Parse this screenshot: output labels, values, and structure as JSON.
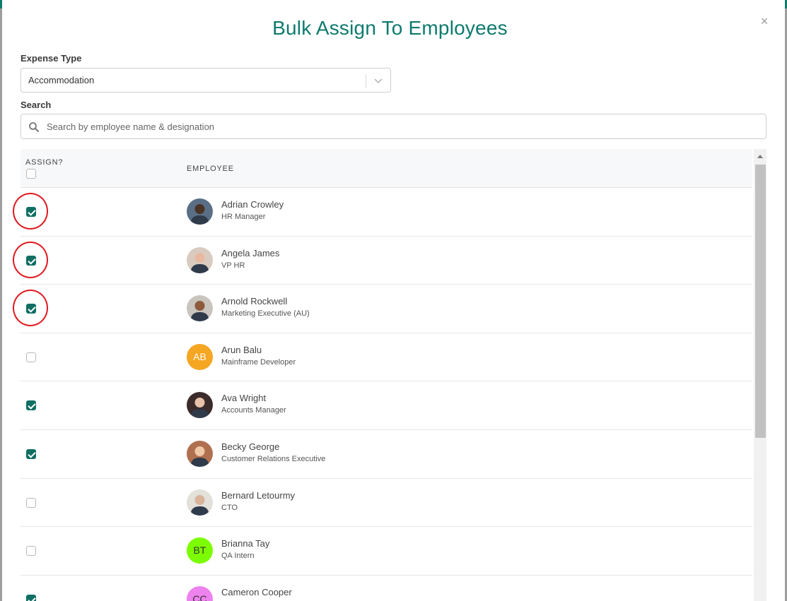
{
  "modal": {
    "title": "Bulk Assign To Employees",
    "close_label": "×"
  },
  "expense_type": {
    "label": "Expense Type",
    "value": "Accommodation"
  },
  "search": {
    "label": "Search",
    "placeholder": "Search by employee name & designation"
  },
  "table": {
    "headers": {
      "assign": "ASSIGN?",
      "employee": "EMPLOYEE"
    },
    "select_all_checked": false,
    "rows": [
      {
        "name": "Adrian Crowley",
        "title": "HR Manager",
        "checked": true,
        "highlighted": true,
        "avatar": {
          "type": "photo",
          "bg": "#5a6f86",
          "skin": "#4a3325"
        }
      },
      {
        "name": "Angela James",
        "title": "VP HR",
        "checked": true,
        "highlighted": true,
        "avatar": {
          "type": "photo",
          "bg": "#d9cbbf",
          "skin": "#e8b9a0"
        }
      },
      {
        "name": "Arnold Rockwell",
        "title": "Marketing Executive (AU)",
        "checked": true,
        "highlighted": true,
        "avatar": {
          "type": "photo",
          "bg": "#c9c4bd",
          "skin": "#8d5a3c"
        }
      },
      {
        "name": "Arun Balu",
        "title": "Mainframe Developer",
        "checked": false,
        "highlighted": false,
        "avatar": {
          "type": "initials",
          "initials": "AB",
          "bg": "#f5a623",
          "color": "#ffffff"
        }
      },
      {
        "name": "Ava Wright",
        "title": "Accounts Manager",
        "checked": true,
        "highlighted": false,
        "avatar": {
          "type": "photo",
          "bg": "#3b2b2b",
          "skin": "#e8c1a8"
        }
      },
      {
        "name": "Becky George",
        "title": "Customer Relations Executive",
        "checked": true,
        "highlighted": false,
        "avatar": {
          "type": "photo",
          "bg": "#b07050",
          "skin": "#f0c8a8"
        }
      },
      {
        "name": "Bernard Letourmy",
        "title": "CTO",
        "checked": false,
        "highlighted": false,
        "avatar": {
          "type": "photo",
          "bg": "#e4e0da",
          "skin": "#d8b49a"
        }
      },
      {
        "name": "Brianna Tay",
        "title": "QA Intern",
        "checked": false,
        "highlighted": false,
        "avatar": {
          "type": "initials",
          "initials": "BT",
          "bg": "#7cfc00",
          "color": "#333333"
        }
      },
      {
        "name": "Cameron Cooper",
        "title": "",
        "checked": true,
        "highlighted": false,
        "avatar": {
          "type": "initials",
          "initials": "CC",
          "bg": "#ee82ee",
          "color": "#333333"
        }
      }
    ]
  },
  "colors": {
    "accent": "#0e7a6e",
    "checkbox_checked": "#0f6f63",
    "highlight": "#e0191f"
  }
}
